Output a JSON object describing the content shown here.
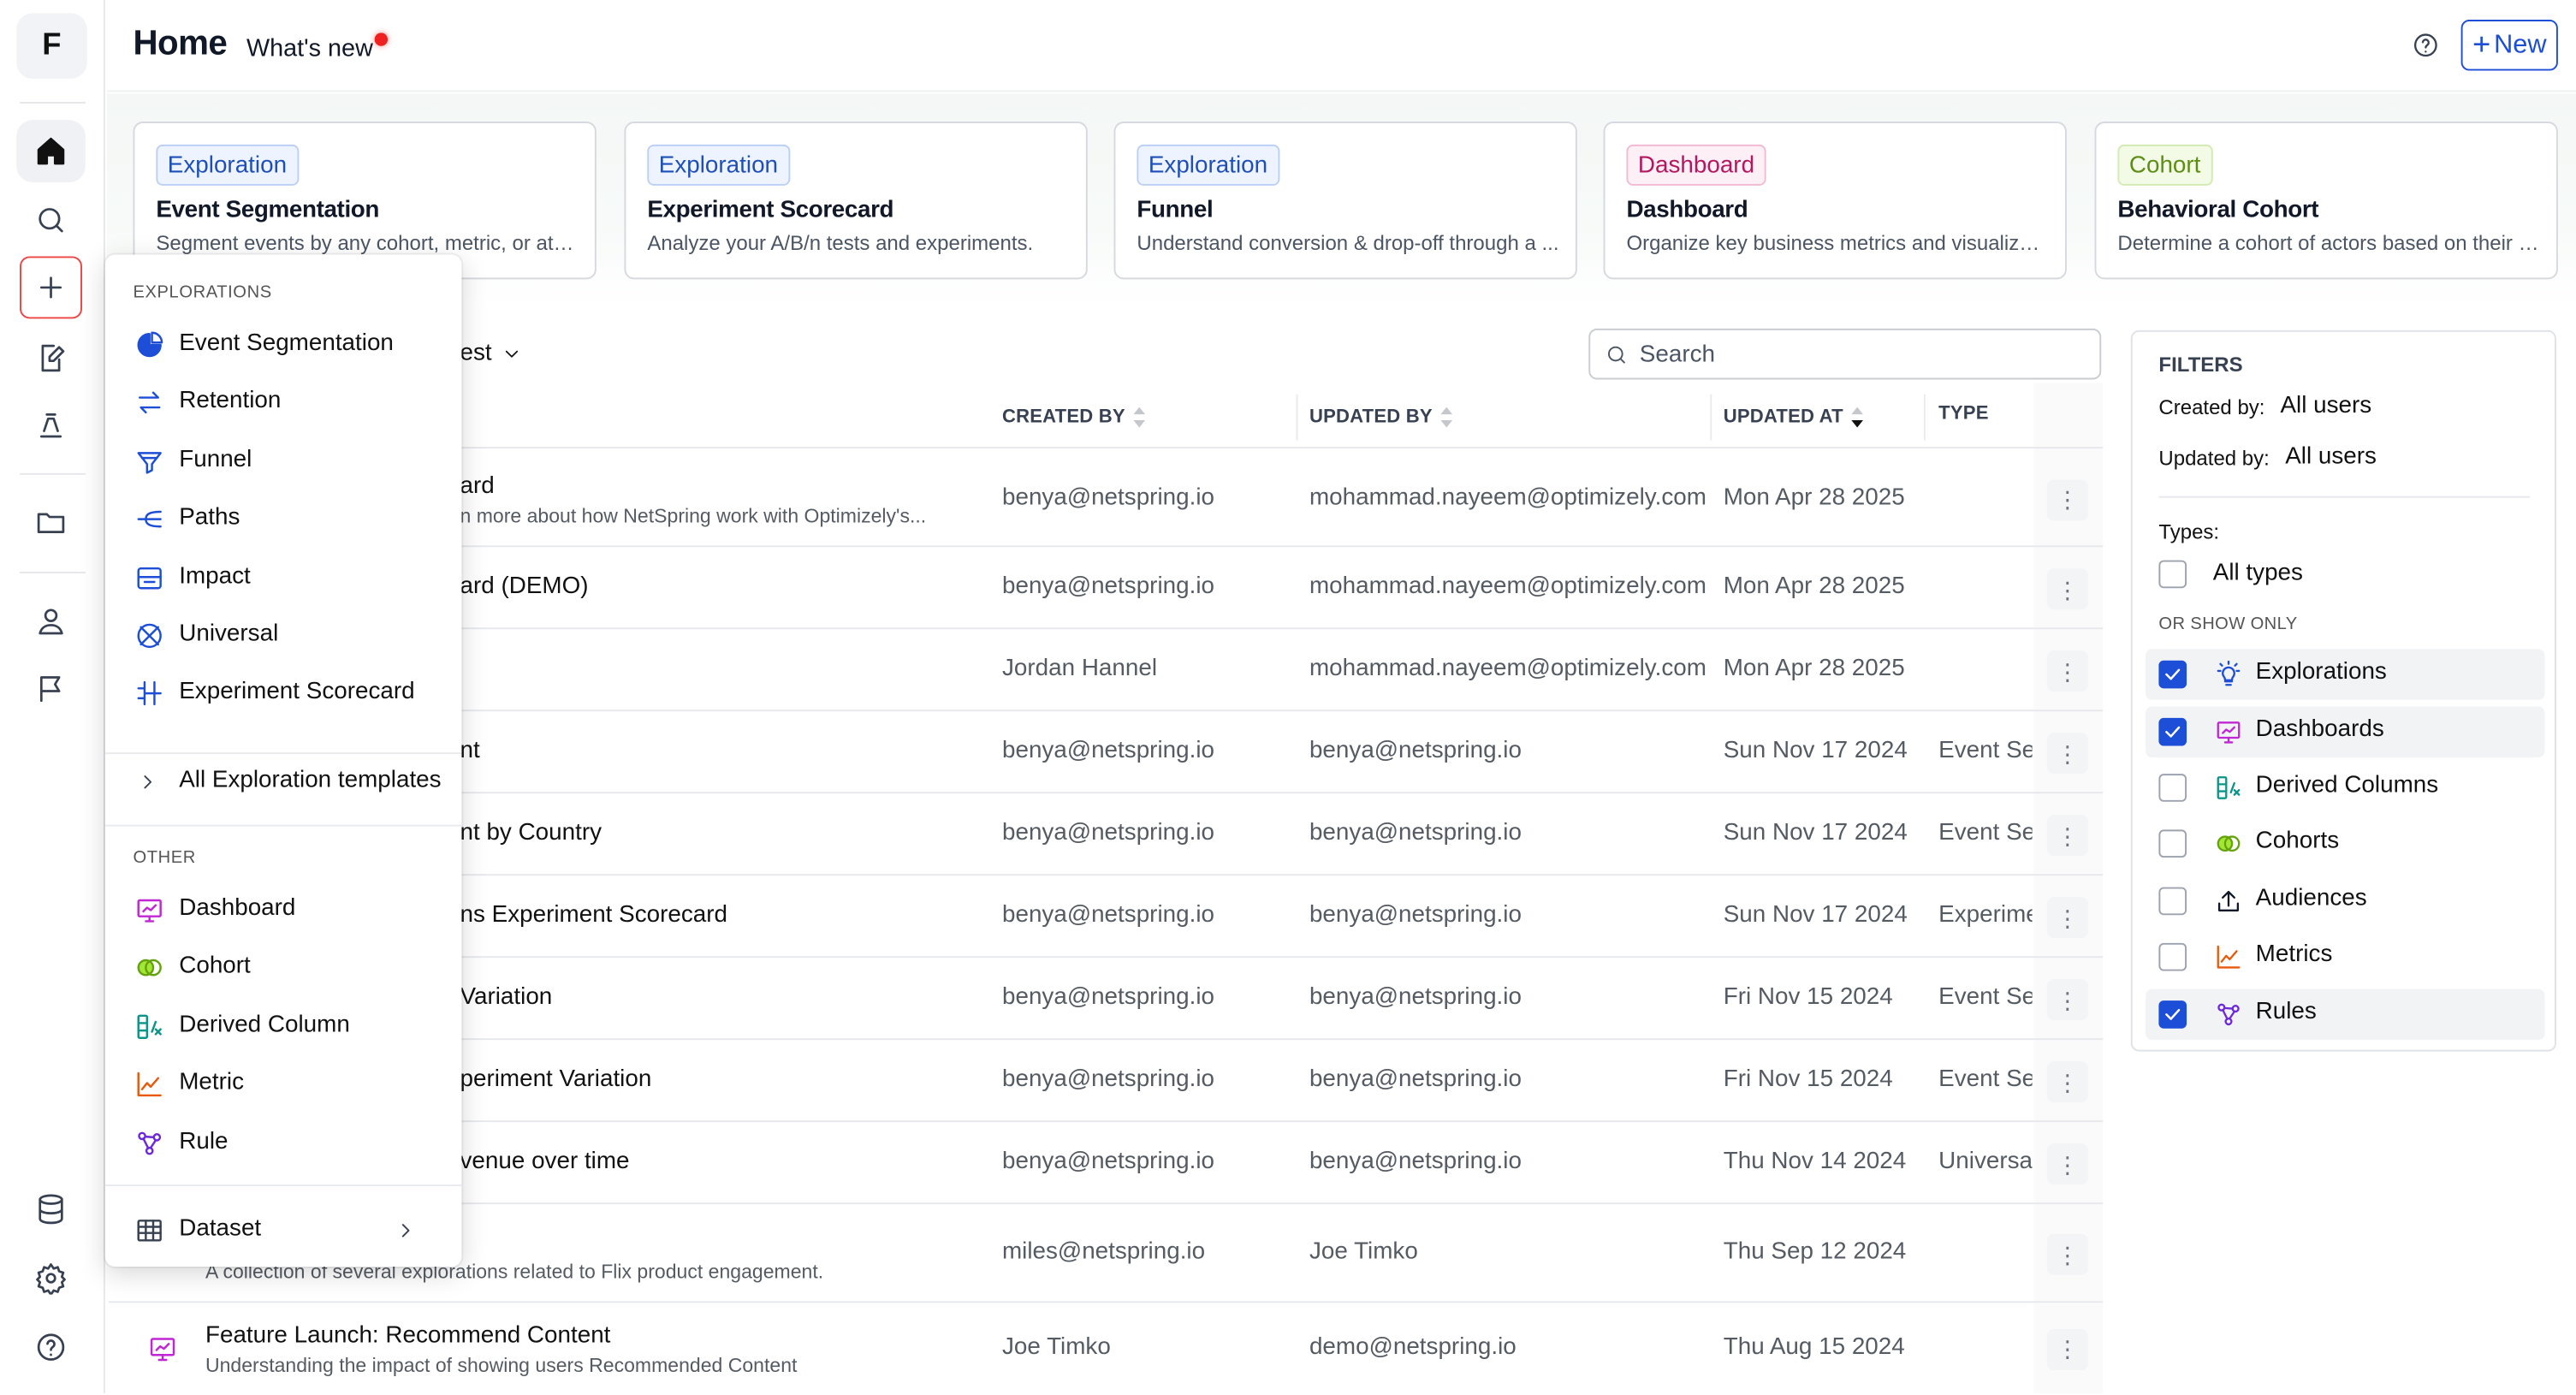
{
  "app": {
    "logo_letter": "F"
  },
  "header": {
    "title": "Home",
    "whats_new": "What's new",
    "new_button": "New"
  },
  "sidebar_icons": [
    "home-icon",
    "search-icon",
    "plus-icon",
    "edit-doc-icon",
    "lab-icon",
    "folder-icon",
    "user-icon",
    "flag-icon",
    "database-icon",
    "gear-icon",
    "help-icon"
  ],
  "template_cards": [
    {
      "tag": "Exploration",
      "title": "Event Segmentation",
      "desc": "Segment events by any cohort, metric, or attri..."
    },
    {
      "tag": "Exploration",
      "title": "Experiment Scorecard",
      "desc": "Analyze your A/B/n tests and experiments."
    },
    {
      "tag": "Exploration",
      "title": "Funnel",
      "desc": "Understand conversion & drop-off through a ..."
    },
    {
      "tag": "Dashboard",
      "title": "Dashboard",
      "desc": "Organize key business metrics and visualizati..."
    },
    {
      "tag": "Cohort",
      "title": "Behavioral Cohort",
      "desc": "Determine a cohort of actors based on their a..."
    }
  ],
  "list": {
    "sort_label": "est",
    "search_placeholder": "Search",
    "columns": {
      "created_by": "CREATED BY",
      "updated_by": "UPDATED BY",
      "updated_at": "UPDATED AT",
      "type": "TYPE"
    },
    "rows": [
      {
        "name": "ard",
        "desc": "n more about how NetSpring work with Optimizely's...",
        "created_by": "benya@netspring.io",
        "updated_by": "mohammad.nayeem@optimizely.com",
        "updated_at": "Mon Apr 28 2025",
        "type": ""
      },
      {
        "name": "ard (DEMO)",
        "desc": "",
        "created_by": "benya@netspring.io",
        "updated_by": "mohammad.nayeem@optimizely.com",
        "updated_at": "Mon Apr 28 2025",
        "type": ""
      },
      {
        "name": "",
        "desc": "",
        "created_by": "Jordan Hannel",
        "updated_by": "mohammad.nayeem@optimizely.com",
        "updated_at": "Mon Apr 28 2025",
        "type": ""
      },
      {
        "name": "nt",
        "desc": "",
        "created_by": "benya@netspring.io",
        "updated_by": "benya@netspring.io",
        "updated_at": "Sun Nov 17 2024",
        "type": "Event Seg"
      },
      {
        "name": "nt by Country",
        "desc": "",
        "created_by": "benya@netspring.io",
        "updated_by": "benya@netspring.io",
        "updated_at": "Sun Nov 17 2024",
        "type": "Event Seg"
      },
      {
        "name": "ns Experiment Scorecard",
        "desc": "",
        "created_by": "benya@netspring.io",
        "updated_by": "benya@netspring.io",
        "updated_at": "Sun Nov 17 2024",
        "type": "Experime"
      },
      {
        "name": "Variation",
        "desc": "",
        "created_by": "benya@netspring.io",
        "updated_by": "benya@netspring.io",
        "updated_at": "Fri Nov 15 2024",
        "type": "Event Seg"
      },
      {
        "name": "periment Variation",
        "desc": "",
        "created_by": "benya@netspring.io",
        "updated_by": "benya@netspring.io",
        "updated_at": "Fri Nov 15 2024",
        "type": "Event Seg"
      },
      {
        "name": "venue over time",
        "desc": "",
        "created_by": "benya@netspring.io",
        "updated_by": "benya@netspring.io",
        "updated_at": "Thu Nov 14 2024",
        "type": "Universal"
      },
      {
        "name": "",
        "desc": "A collection of several explorations related to Flix product engagement.",
        "created_by": "miles@netspring.io",
        "updated_by": "Joe Timko",
        "updated_at": "Thu Sep 12 2024",
        "type": ""
      },
      {
        "name": "Feature Launch: Recommend Content",
        "desc": "Understanding the impact of showing users Recommended Content",
        "created_by": "Joe Timko",
        "updated_by": "demo@netspring.io",
        "updated_at": "Thu Aug 15 2024",
        "type": ""
      }
    ]
  },
  "filters": {
    "heading": "FILTERS",
    "created_by_label": "Created by:",
    "created_by_value": "All users",
    "updated_by_label": "Updated by:",
    "updated_by_value": "All users",
    "types_label": "Types:",
    "all_types": "All types",
    "show_only_label": "OR SHOW ONLY",
    "options": [
      {
        "label": "Explorations",
        "checked": true,
        "icon": "bulb-icon",
        "color": "#1d4ed8"
      },
      {
        "label": "Dashboards",
        "checked": true,
        "icon": "dashboard-icon",
        "color": "#c026d3"
      },
      {
        "label": "Derived Columns",
        "checked": false,
        "icon": "derived-column-icon",
        "color": "#0d9488"
      },
      {
        "label": "Cohorts",
        "checked": false,
        "icon": "cohort-icon",
        "color": "#65a30d"
      },
      {
        "label": "Audiences",
        "checked": false,
        "icon": "upload-icon",
        "color": "#111827"
      },
      {
        "label": "Metrics",
        "checked": false,
        "icon": "metric-icon",
        "color": "#ea580c"
      },
      {
        "label": "Rules",
        "checked": true,
        "icon": "rule-icon",
        "color": "#6d28d9"
      }
    ]
  },
  "create_menu": {
    "explorations_label": "EXPLORATIONS",
    "explorations": [
      {
        "label": "Event Segmentation",
        "icon": "pie-icon"
      },
      {
        "label": "Retention",
        "icon": "retention-icon"
      },
      {
        "label": "Funnel",
        "icon": "funnel-icon"
      },
      {
        "label": "Paths",
        "icon": "paths-icon"
      },
      {
        "label": "Impact",
        "icon": "impact-icon"
      },
      {
        "label": "Universal",
        "icon": "universal-icon"
      },
      {
        "label": "Experiment Scorecard",
        "icon": "scorecard-icon"
      }
    ],
    "all_templates": "All Exploration templates",
    "other_label": "OTHER",
    "other": [
      {
        "label": "Dashboard",
        "icon": "dashboard-icon"
      },
      {
        "label": "Cohort",
        "icon": "cohort-icon"
      },
      {
        "label": "Derived Column",
        "icon": "derived-column-icon"
      },
      {
        "label": "Metric",
        "icon": "metric-icon"
      },
      {
        "label": "Rule",
        "icon": "rule-icon"
      }
    ],
    "dataset": "Dataset"
  }
}
